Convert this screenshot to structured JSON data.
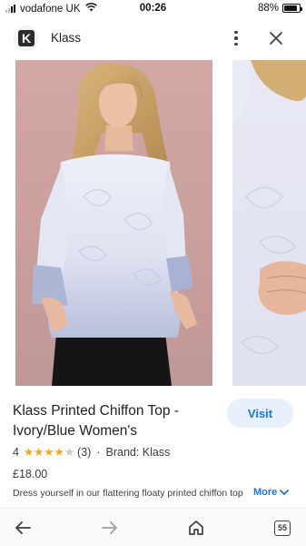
{
  "status_bar": {
    "carrier": "vodafone UK",
    "time": "00:26",
    "battery_percent": "88%",
    "battery_level": 0.88,
    "signal_bars": 2
  },
  "header": {
    "app_name": "Klass",
    "logo_letter": "K",
    "more_icon": "vertical-dots-icon",
    "close_icon": "close-icon"
  },
  "product": {
    "title": "Klass Printed Chiffon Top - Ivory/Blue Women's",
    "visit_label": "Visit",
    "rating": "4",
    "rating_stars": 4,
    "rating_max": 5,
    "review_count": "(3)",
    "separator": "·",
    "brand": "Brand: Klass",
    "price": "£18.00",
    "description": "Dress yourself in our flattering floaty printed chiffon top",
    "more_label": "More"
  },
  "bottom_nav": {
    "tab_count": "55"
  },
  "colors": {
    "accent": "#1a73e8",
    "visit_bg": "#e8f0fe",
    "star": "#f4a623",
    "photo_bg": "#cfa5a1"
  }
}
